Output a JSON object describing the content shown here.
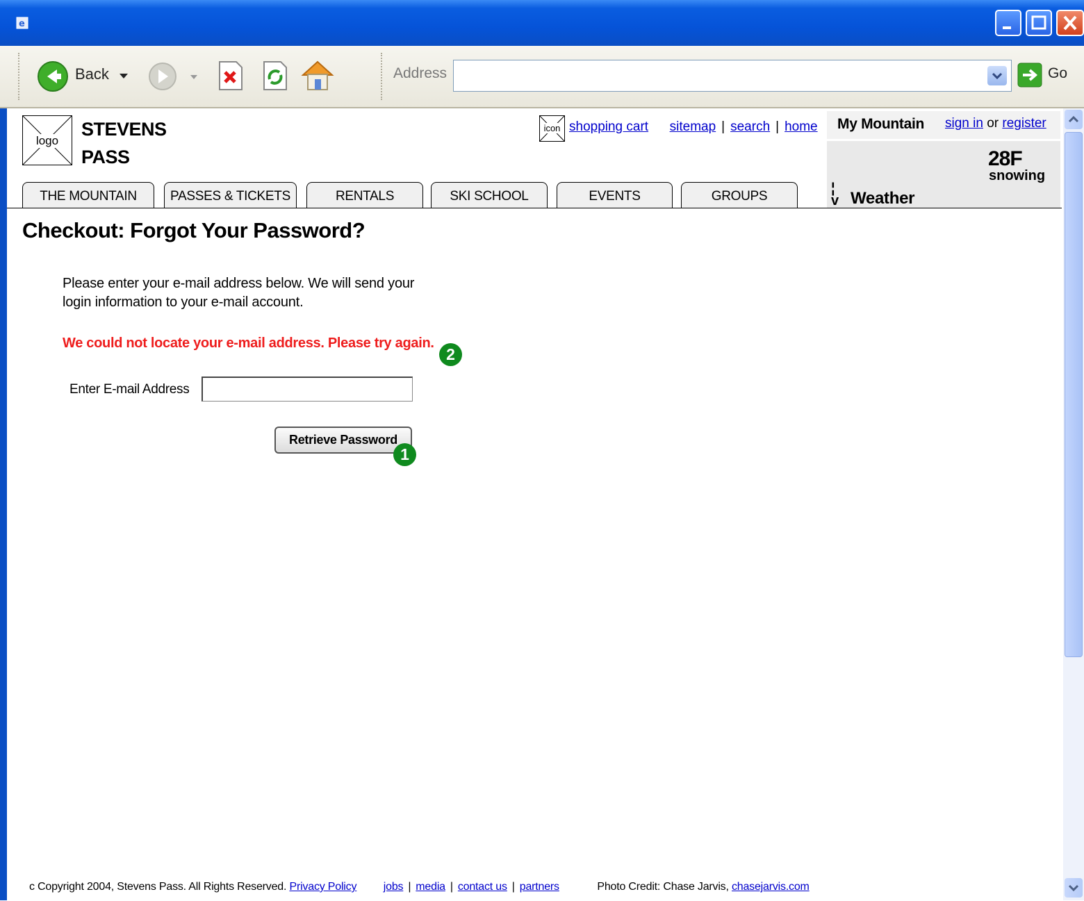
{
  "browser": {
    "back_label": "Back",
    "address_label": "Address",
    "address_value": "",
    "go_label": "Go"
  },
  "header": {
    "logo_text": "logo",
    "brand_line1": "STEVENS",
    "brand_line2": "PASS",
    "cart_icon_text": "icon",
    "links": {
      "shopping_cart": "shopping cart",
      "sitemap": "sitemap",
      "search": "search",
      "home": "home"
    }
  },
  "my_mountain": {
    "title": "My Mountain",
    "sign_in": "sign in",
    "or": "or",
    "register": "register"
  },
  "weather": {
    "temperature": "28F",
    "condition": "snowing",
    "label": "Weather"
  },
  "tabs": [
    {
      "label": "THE MOUNTAIN"
    },
    {
      "label": "PASSES & TICKETS"
    },
    {
      "label": "RENTALS"
    },
    {
      "label": "SKI SCHOOL"
    },
    {
      "label": "EVENTS"
    },
    {
      "label": "GROUPS"
    }
  ],
  "content": {
    "title": "Checkout: Forgot Your Password?",
    "intro": "Please enter your e-mail address below. We will send your login information to your e-mail account.",
    "error": "We could not locate your e-mail address. Please try again.",
    "email_label": "Enter E-mail Address",
    "email_value": "",
    "button_label": "Retrieve Password",
    "badge_1": "1",
    "badge_2": "2"
  },
  "footer": {
    "copyright": "c Copyright 2004, Stevens Pass. All Rights Reserved.",
    "privacy": "Privacy Policy",
    "jobs": "jobs",
    "media": "media",
    "contact": "contact us",
    "partners": "partners",
    "photo_credit": "Photo Credit: Chase Jarvis,",
    "photo_link": "chasejarvis.com"
  },
  "colors": {
    "titlebar": "#0553d8",
    "link": "#0000cc",
    "error": "#ee1c1c",
    "badge": "#0f8a1e"
  }
}
